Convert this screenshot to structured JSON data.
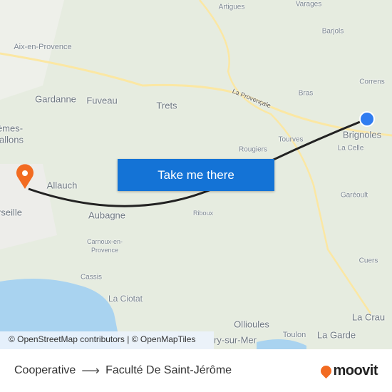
{
  "map": {
    "labels": {
      "artigues": "Artigues",
      "varages": "Varages",
      "barjols": "Barjols",
      "aix": "Aix-en-Provence",
      "correns": "Correns",
      "bras": "Bras",
      "provencale": "La Provençale",
      "gardanne": "Gardanne",
      "fuveau": "Fuveau",
      "trets": "Trets",
      "brignoles": "Brignoles",
      "tourves": "Tourves",
      "pennes1": "èmes-",
      "pennes2": "allons",
      "rougiers": "Rougiers",
      "lacelle": "La Celle",
      "allauch": "Allauch",
      "gareoult": "Garéoult",
      "marseille": "rseille",
      "aubagne": "Aubagne",
      "riboux": "Riboux",
      "carnoux1": "Carnoux-en-",
      "carnoux2": "Provence",
      "cuers": "Cuers",
      "cassis": "Cassis",
      "laciotat": "La Ciotat",
      "ollioules": "Ollioules",
      "lacrau": "La Crau",
      "toulon": "Toulon",
      "lagarde": "La Garde",
      "sixfours": "ry-sur-Mer"
    },
    "cta_label": "Take me there",
    "attribution": "© OpenStreetMap contributors | © OpenMapTiles",
    "origin_color": "#2f7cf0",
    "destination_color": "#f26b21"
  },
  "footer": {
    "origin": "Cooperative",
    "destination": "Faculté De Saint-Jérôme",
    "brand": "moovit"
  }
}
